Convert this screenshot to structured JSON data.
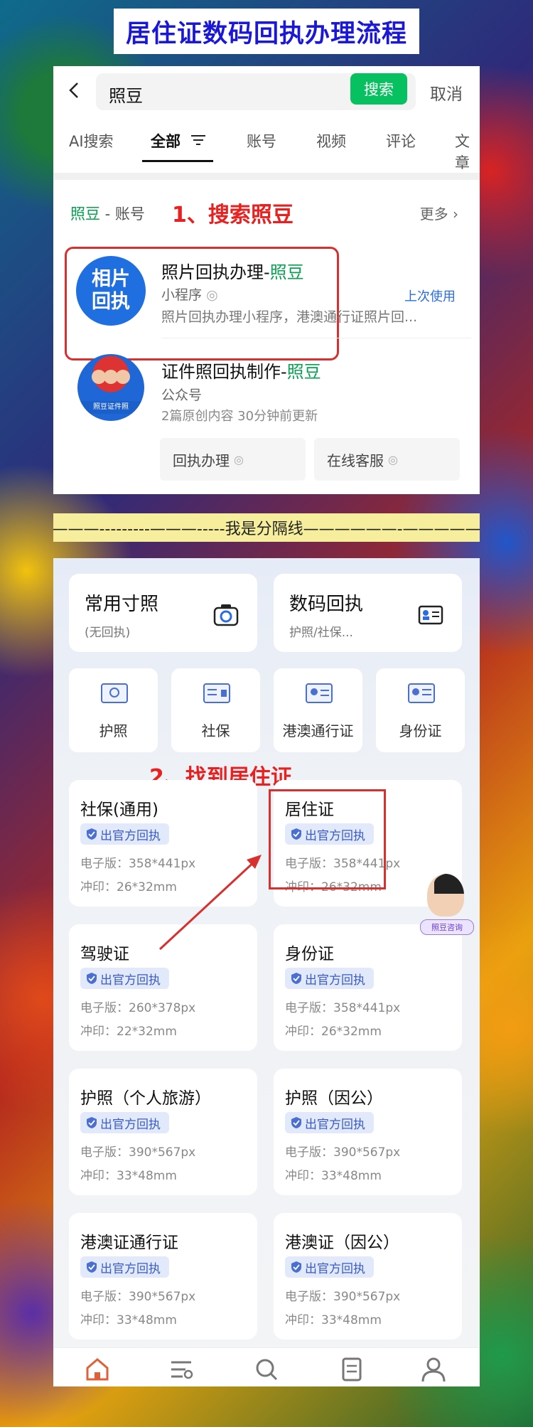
{
  "banner": "居住证数码回执办理流程",
  "search": {
    "query": "照豆",
    "search_btn": "搜索",
    "cancel": "取消"
  },
  "tabs": [
    "AI搜索",
    "全部",
    "账号",
    "视频",
    "评论",
    "文章"
  ],
  "section": {
    "name": "照豆",
    "suffix": " - 账号",
    "more": "更多"
  },
  "annotations": {
    "step1": "1、搜索照豆",
    "step2": "2、找到居住证"
  },
  "result1": {
    "logo": [
      "相片",
      "回执"
    ],
    "title": "照片回执办理-",
    "title_hl": "照豆",
    "type": "小程序",
    "last_used": "上次使用",
    "desc": "照片回执办理小程序，港澳通行证照片回..."
  },
  "result2": {
    "logo_band": "照豆证件照",
    "title": "证件照回执制作-",
    "title_hl": "照豆",
    "type": "公众号",
    "desc": "2篇原创内容  30分钟前更新",
    "chips": [
      "回执办理",
      "在线客服"
    ]
  },
  "divider_text": "———---------———-----我是分隔线——————-—————",
  "top_cards": [
    {
      "title": "常用寸照",
      "sub": "(无回执)",
      "icon": "camera-icon"
    },
    {
      "title": "数码回执",
      "sub": "护照/社保...",
      "icon": "id-card-icon"
    }
  ],
  "categories": [
    {
      "label": "护照",
      "icon": "passport-icon"
    },
    {
      "label": "社保",
      "icon": "social-security-icon"
    },
    {
      "label": "港澳通行证",
      "icon": "travel-permit-icon"
    },
    {
      "label": "身份证",
      "icon": "id-icon"
    }
  ],
  "badge": "出官方回执",
  "documents": [
    {
      "name": "社保(通用)",
      "e": "电子版：358*441px",
      "p": "冲印：26*32mm"
    },
    {
      "name": "居住证",
      "e": "电子版：358*441px",
      "p": "冲印：26*32mm"
    },
    {
      "name": "驾驶证",
      "e": "电子版：260*378px",
      "p": "冲印：22*32mm"
    },
    {
      "name": "身份证",
      "e": "电子版：358*441px",
      "p": "冲印：26*32mm"
    },
    {
      "name": "护照（个人旅游）",
      "e": "电子版：390*567px",
      "p": "冲印：33*48mm"
    },
    {
      "name": "护照（因公）",
      "e": "电子版：390*567px",
      "p": "冲印：33*48mm"
    },
    {
      "name": "港澳证通行证",
      "e": "电子版：390*567px",
      "p": "冲印：33*48mm"
    },
    {
      "name": "港澳证（因公）",
      "e": "电子版：390*567px",
      "p": "冲印：33*48mm"
    }
  ],
  "consult": "照豆咨询",
  "nav": [
    "home-icon",
    "list-icon",
    "search-icon",
    "document-icon",
    "profile-icon"
  ],
  "colors": {
    "green": "#07c160",
    "red_annotation": "#e82020",
    "badge_blue": "#3a5cc4"
  }
}
